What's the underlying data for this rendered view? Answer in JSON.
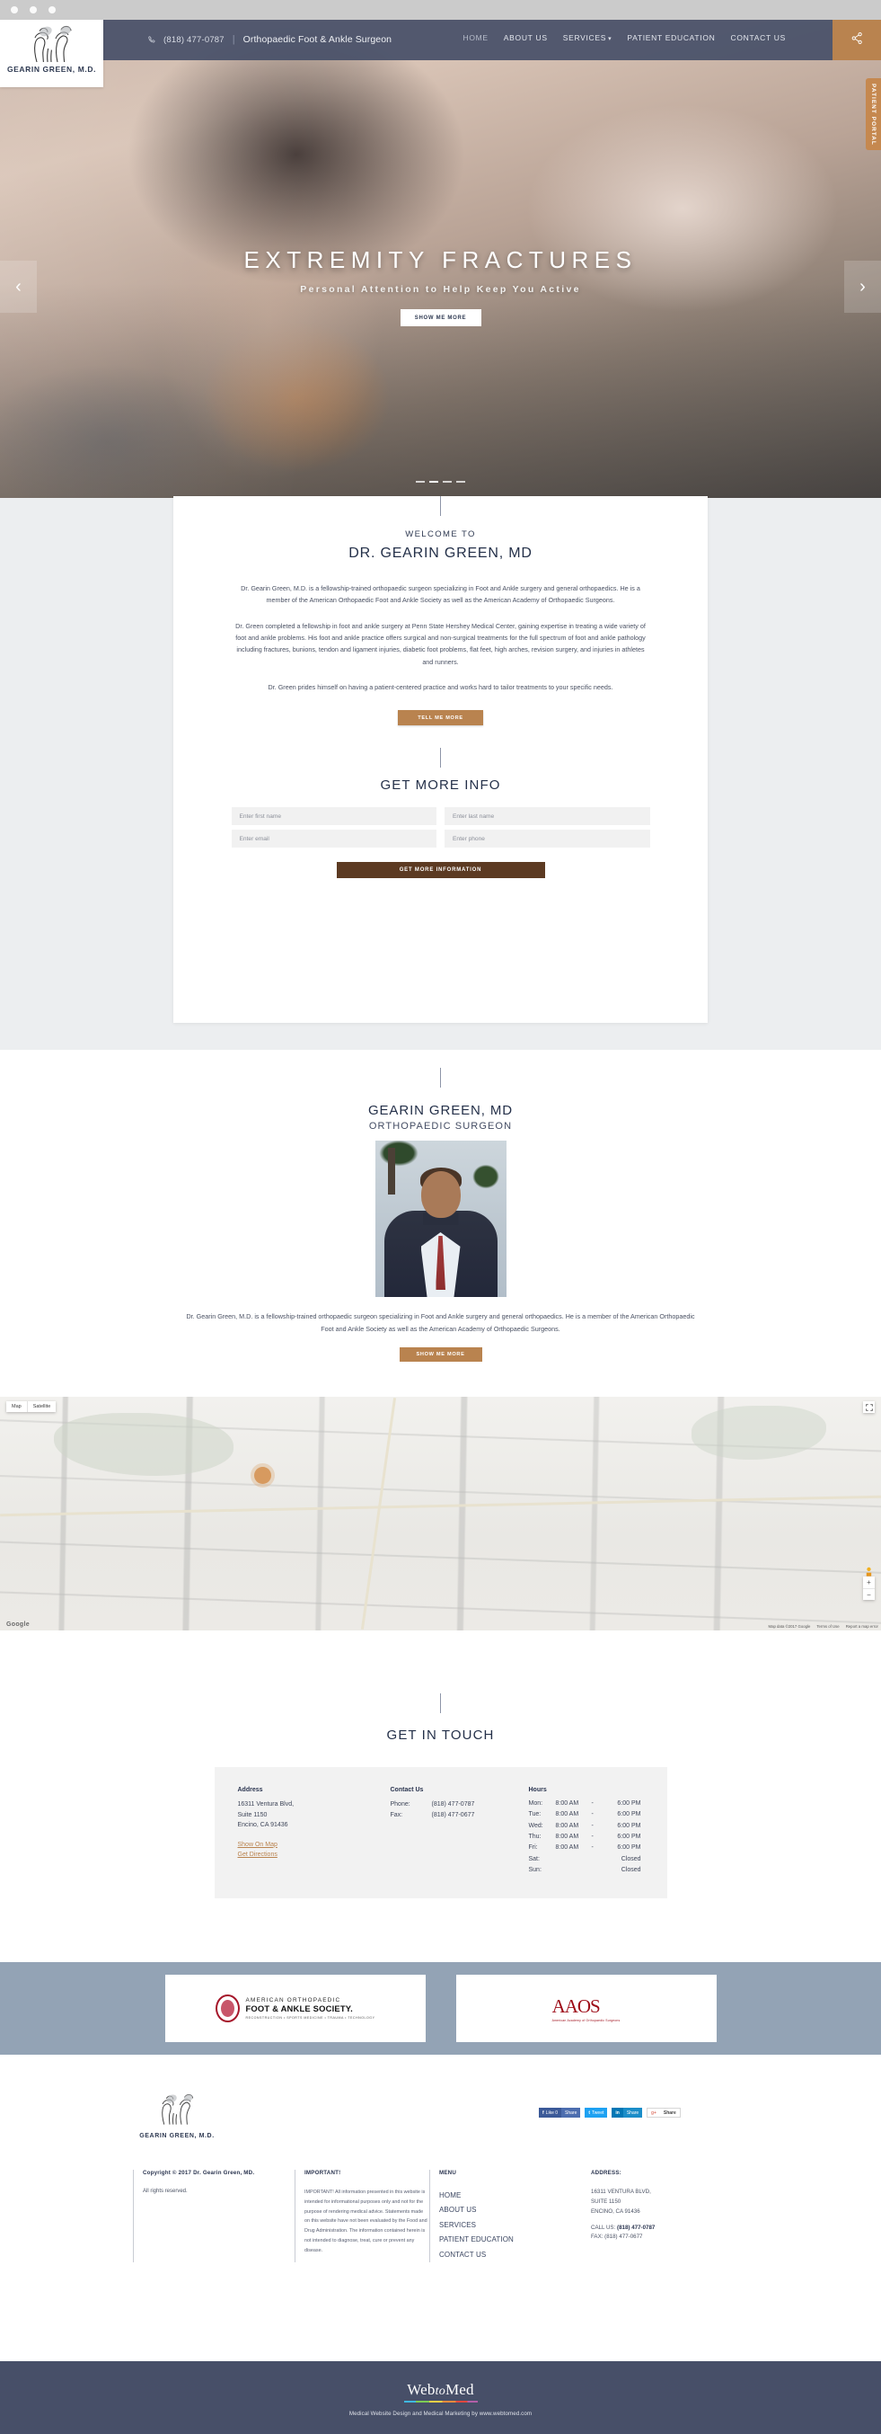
{
  "browser": {
    "dots": 3
  },
  "header": {
    "logo_name": "GEARIN GREEN, M.D.",
    "phone": "(818) 477-0787",
    "separator": "|",
    "tagline": "Orthopaedic Foot & Ankle Surgeon",
    "nav": [
      {
        "label": "HOME",
        "active": true
      },
      {
        "label": "ABOUT US",
        "active": false
      },
      {
        "label": "SERVICES",
        "active": false,
        "caret": "▾"
      },
      {
        "label": "PATIENT EDUCATION",
        "active": false
      },
      {
        "label": "CONTACT US",
        "active": false
      }
    ],
    "share_icon": "share-icon",
    "portal_tab": "PATIENT PORTAL"
  },
  "hero": {
    "title": "EXTREMITY FRACTURES",
    "subtitle": "Personal Attention to Help Keep You Active",
    "button": "SHOW ME MORE",
    "prev_arrow": "‹",
    "next_arrow": "›",
    "slides": 4,
    "active_slide": 2
  },
  "welcome": {
    "eyebrow": "WELCOME TO",
    "title": "DR. GEARIN GREEN, MD",
    "p1": "Dr. Gearin Green, M.D. is a fellowship-trained orthopaedic surgeon specializing in Foot and Ankle surgery and general orthopaedics. He is a member of the American Orthopaedic Foot and Ankle Society as well as the American Academy of Orthopaedic Surgeons.",
    "p2": "Dr. Green completed a fellowship in foot and ankle surgery at Penn State Hershey Medical Center, gaining expertise in treating a wide variety of foot and ankle problems. His foot and ankle practice offers surgical and non-surgical treatments for the full spectrum of foot and ankle pathology including fractures, bunions, tendon and ligament injuries, diabetic foot problems, flat feet, high arches, revision surgery, and injuries in athletes and runners.",
    "p3": "Dr. Green prides himself on having a patient-centered practice and works hard to tailor treatments to your specific needs.",
    "button": "TELL ME MORE"
  },
  "get_more_info": {
    "title": "GET MORE INFO",
    "first_name_placeholder": "Enter first name",
    "last_name_placeholder": "Enter last name",
    "email_placeholder": "Enter email",
    "phone_placeholder": "Enter phone",
    "submit": "GET MORE INFORMATION"
  },
  "doctor": {
    "name": "GEARIN GREEN, MD",
    "role": "ORTHOPAEDIC SURGEON",
    "photo_alt": "doctor-portrait",
    "description": "Dr. Gearin Green, M.D. is a fellowship-trained orthopaedic surgeon specializing in Foot and Ankle surgery and general orthopaedics. He is a member of the American Orthopaedic Foot and Ankle Society as well as the American Academy of Orthopaedic Surgeons.",
    "button": "SHOW ME MORE"
  },
  "map": {
    "type_map": "Map",
    "type_satellite": "Satellite",
    "zoom_in": "+",
    "zoom_out": "−",
    "logo": "Google",
    "credit": "Map data ©2017 Google",
    "terms": "Terms of Use",
    "report": "Report a map error"
  },
  "contact": {
    "title": "GET IN TOUCH",
    "address_heading": "Address",
    "address_line1": "16311 Ventura Blvd,",
    "address_line2": "Suite 1150",
    "address_line3": "Encino, CA 91436",
    "show_on_map": "Show On Map",
    "get_directions": "Get Directions",
    "contact_heading": "Contact Us",
    "phone_label": "Phone:",
    "phone_value": "(818) 477-0787",
    "fax_label": "Fax:",
    "fax_value": "(818) 477-0677",
    "hours_heading": "Hours",
    "hours": [
      {
        "day": "Mon:",
        "open": "8:00 AM",
        "dash": "-",
        "close": "6:00 PM",
        "closed": ""
      },
      {
        "day": "Tue:",
        "open": "8:00 AM",
        "dash": "-",
        "close": "6:00 PM",
        "closed": ""
      },
      {
        "day": "Wed:",
        "open": "8:00 AM",
        "dash": "-",
        "close": "6:00 PM",
        "closed": ""
      },
      {
        "day": "Thu:",
        "open": "8:00 AM",
        "dash": "-",
        "close": "6:00 PM",
        "closed": ""
      },
      {
        "day": "Fri:",
        "open": "8:00 AM",
        "dash": "-",
        "close": "6:00 PM",
        "closed": ""
      },
      {
        "day": "Sat:",
        "open": "",
        "dash": "",
        "close": "",
        "closed": "Closed"
      },
      {
        "day": "Sun:",
        "open": "",
        "dash": "",
        "close": "",
        "closed": "Closed"
      }
    ]
  },
  "associations": {
    "aofas_line1": "AMERICAN ORTHOPAEDIC",
    "aofas_line2": "FOOT & ANKLE SOCIETY.",
    "aofas_line3": "RECONSTRUCTION • SPORTS MEDICINE • TRAUMA • TECHNOLOGY",
    "aaos_mark": "AAOS",
    "aaos_sub": "American Academy of Orthopaedic Surgeons"
  },
  "footer": {
    "logo_name": "GEARIN GREEN, M.D.",
    "social": [
      {
        "network": "facebook",
        "action": "Like 0",
        "share": "Share"
      },
      {
        "network": "twitter",
        "action": "Tweet",
        "share": ""
      },
      {
        "network": "linkedin",
        "action": "in",
        "share": "Share"
      },
      {
        "network": "google-plus",
        "action": "g+",
        "share": "Share"
      }
    ],
    "copyright_heading": "Copyright © 2017 Dr. Gearin Green, MD.",
    "copyright_body": "All rights reserved.",
    "important_heading": "IMPORTANT!",
    "important_body": "IMPORTANT! All information presented in this website is intended for informational purposes only and not for the purpose of rendering medical advice. Statements made on this website have not been evaluated by the Food and Drug Administration. The information contained herein is not intended to diagnose, treat, cure or prevent any disease.",
    "menu_heading": "MENU",
    "menu": [
      "HOME",
      "ABOUT US",
      "SERVICES",
      "PATIENT EDUCATION",
      "CONTACT US"
    ],
    "address_heading": "ADDRESS:",
    "address_line1": "16311 VENTURA BLVD,",
    "address_line2": "SUITE 1150",
    "address_line3": "ENCINO, CA 91436",
    "call_label": "CALL US:",
    "call_value": "(818) 477-0787",
    "fax_label": "FAX:",
    "fax_value": "(818) 477-0677"
  },
  "bottom": {
    "brand_web": "Web",
    "brand_to": "to",
    "brand_med": "Med",
    "caption": "Medical Website Design and Medical Marketing by www.webtomed.com"
  },
  "colors": {
    "navy": "#474f68",
    "tan": "#b9834f",
    "brown": "#5c3a22",
    "steel": "#93a3b5",
    "grey_band": "#eceef0"
  }
}
